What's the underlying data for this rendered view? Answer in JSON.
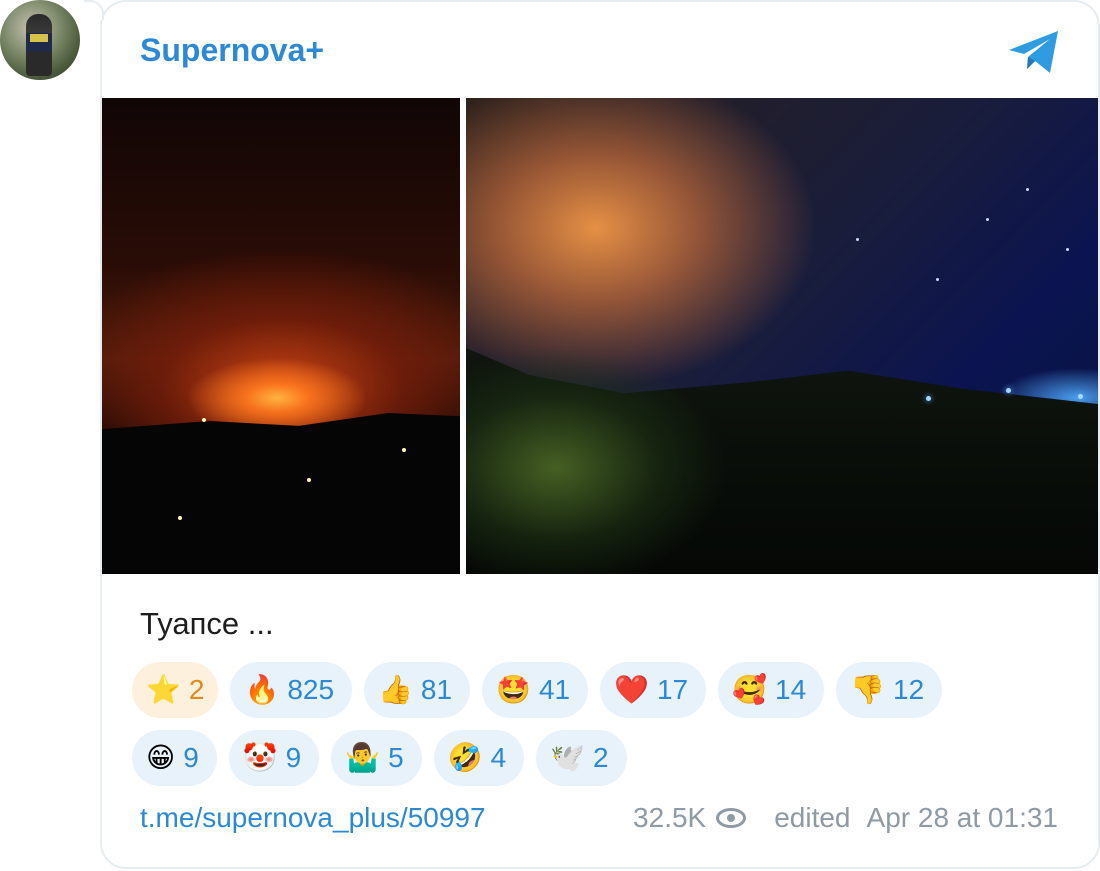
{
  "channel": {
    "name": "Supernova+",
    "caption": "Туапсе ...",
    "link": "t.me/supernova_plus/50997",
    "views": "32.5K",
    "edited_label": "edited",
    "date": "Apr 28 at 01:31"
  },
  "reactions": {
    "row1": [
      {
        "emoji": "⭐",
        "count": "2",
        "mine": true
      },
      {
        "emoji": "🔥",
        "count": "825"
      },
      {
        "emoji": "👍",
        "count": "81"
      },
      {
        "emoji": "🤩",
        "count": "41"
      },
      {
        "emoji": "❤️",
        "count": "17"
      },
      {
        "emoji": "🥰",
        "count": "14"
      },
      {
        "emoji": "👎",
        "count": "12"
      }
    ],
    "row2": [
      {
        "emoji": "😁",
        "count": "9"
      },
      {
        "emoji": "🤡",
        "count": "9"
      },
      {
        "emoji": "🤷‍♂️",
        "count": "5"
      },
      {
        "emoji": "🤣",
        "count": "4"
      },
      {
        "emoji": "🕊️",
        "count": "2"
      }
    ]
  },
  "colors": {
    "accent": "#2b89d5",
    "meta": "#8e9aa5",
    "chip_bg": "#e8f2fb",
    "chip_mine_bg": "#fdf0dd"
  },
  "icons": {
    "logo": "telegram-paper-plane-icon",
    "views": "eye-icon"
  }
}
